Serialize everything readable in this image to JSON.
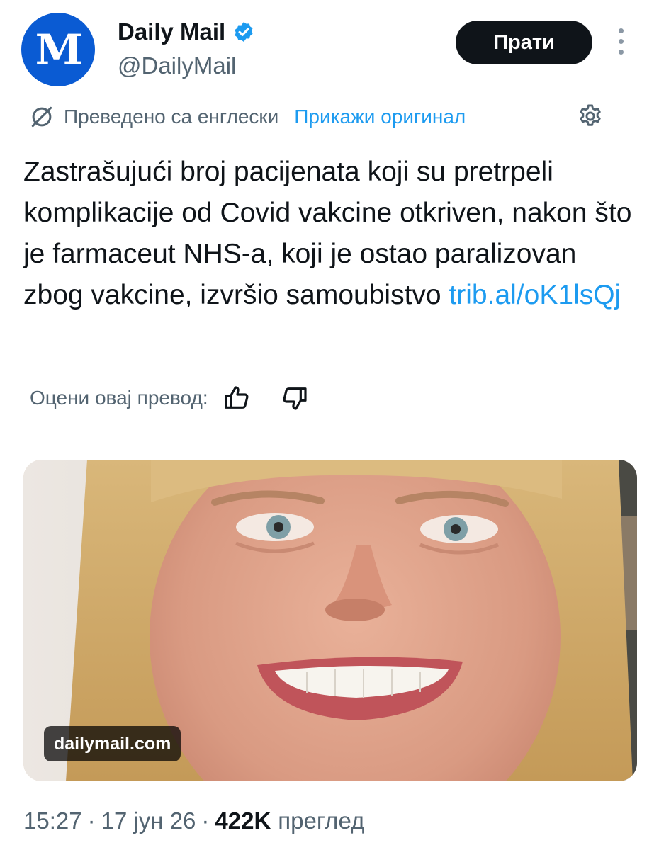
{
  "author": {
    "name": "Daily Mail",
    "handle": "@DailyMail",
    "avatar_text": "M"
  },
  "follow_button_label": "Прати",
  "translation": {
    "translated_label": "Преведено са енглески",
    "show_original_label": "Прикажи оригинал"
  },
  "tweet": {
    "text": "Zastrašujući broj pacijenata koji su pretrpeli komplikacije od Covid vakcine otkriven, nakon što je farmaceut NHS-a, koji je ostao paralizovan zbog vakcine, izvršio samoubistvo ",
    "link": "trib.al/oK1lsQj"
  },
  "rating": {
    "label": "Оцени овај превод:"
  },
  "media": {
    "source": "dailymail.com"
  },
  "meta": {
    "time": "15:27",
    "date": "17 јун 26",
    "separator": "·",
    "views_count": "422K",
    "views_label": "преглед"
  },
  "colors": {
    "accent": "#1d9bf0",
    "avatar_bg": "#0a5bd3",
    "button_bg": "#0f1419",
    "secondary_text": "#536471"
  },
  "icons": {
    "verified": "verified-badge-icon",
    "more": "more-options-icon",
    "translate": "translate-icon",
    "settings": "gear-icon",
    "thumb_up": "thumbs-up-icon",
    "thumb_down": "thumbs-down-icon"
  }
}
